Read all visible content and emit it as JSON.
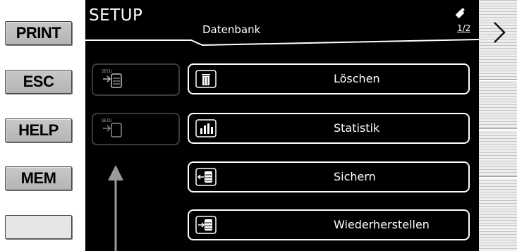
{
  "hardware_keys": [
    {
      "label": "PRINT"
    },
    {
      "label": "ESC"
    },
    {
      "label": "HELP"
    },
    {
      "label": "MEM"
    },
    {
      "label": ""
    }
  ],
  "header": {
    "title": "SETUP",
    "subtitle": "Datenbank",
    "page_indicator": "1/2",
    "usb_icon": "usb-stick-icon"
  },
  "memory_boxes": [
    {
      "text": "SECU",
      "icon": "secu-import-icon"
    },
    {
      "text": "SECU",
      "icon": "secu-export-icon"
    }
  ],
  "buttons": [
    {
      "label": "Löschen",
      "icon": "trash-icon"
    },
    {
      "label": "Statistik",
      "icon": "bar-chart-icon"
    },
    {
      "label": "Sichern",
      "icon": "database-backup-icon"
    },
    {
      "label": "Wiederherstellen",
      "icon": "database-restore-icon"
    }
  ],
  "softkeys": {
    "next_icon": "chevron-right-icon"
  },
  "colors": {
    "screen_bg": "#000000",
    "text": "#ffffff",
    "key_bg": "#c0c0c0"
  }
}
